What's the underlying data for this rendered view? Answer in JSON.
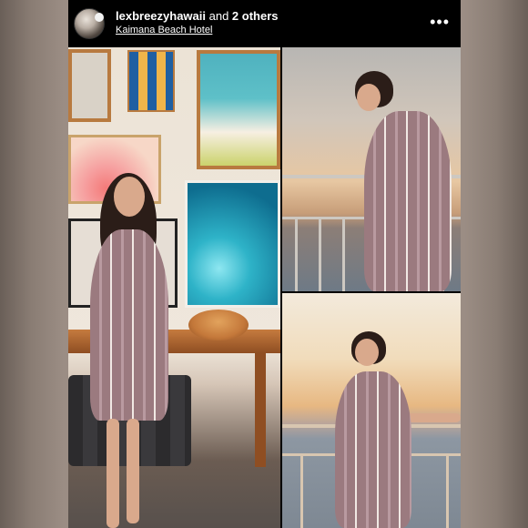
{
  "post": {
    "username": "lexbreezyhawaii",
    "others_prefix": " and ",
    "others_count": "2 others",
    "location": "Kaimana Beach Hotel",
    "more_icon": "more-options-icon"
  },
  "colors": {
    "header_bg": "#000000",
    "header_text": "#ffffff"
  }
}
